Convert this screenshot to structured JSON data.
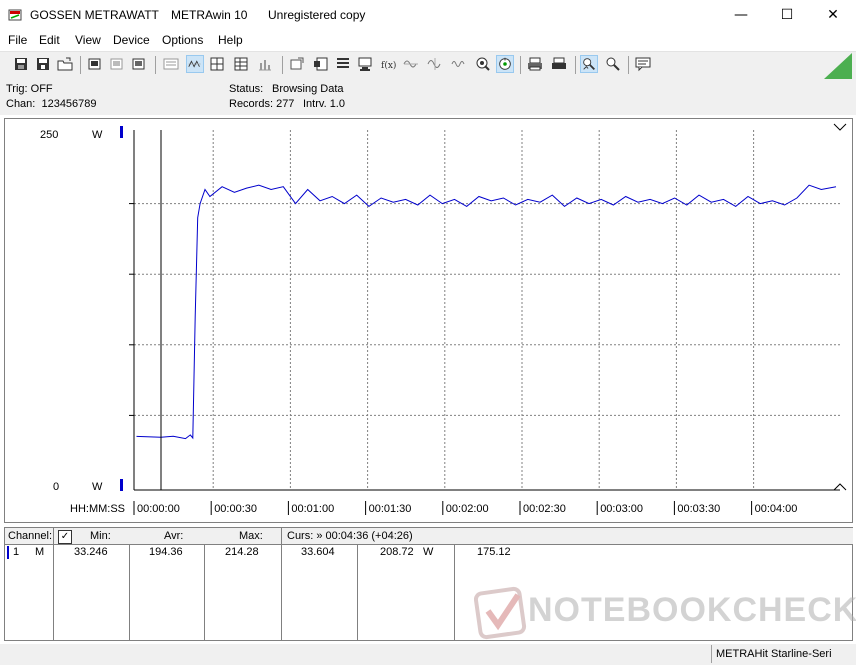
{
  "window": {
    "brand": "GOSSEN METRAWATT",
    "app_name": "METRAwin 10",
    "license": "Unregistered copy",
    "minimize_glyph": "—",
    "maximize_glyph": "☐",
    "close_glyph": "✕"
  },
  "menu": {
    "items": [
      "File",
      "Edit",
      "View",
      "Device",
      "Options",
      "Help"
    ]
  },
  "toolbar": {
    "icons": [
      "save-icon",
      "save-as-icon",
      "open-icon",
      "print-setup-icon",
      "device-icon",
      "device-disabled-icon",
      "grid-icon",
      "waveform-icon",
      "crosshair-icon",
      "table-icon",
      "bars-icon",
      "export-icon",
      "import-icon",
      "list-icon",
      "computer-icon",
      "formula-icon",
      "sine-icon",
      "sine-2-icon",
      "sine-3-icon",
      "probe-icon",
      "trigger-icon",
      "print-icon",
      "print-preview-icon",
      "zoom-icon",
      "cursor-icon",
      "message-icon"
    ],
    "active": [
      "waveform-icon",
      "trigger-icon",
      "zoom-icon"
    ]
  },
  "status": {
    "trig": "Trig: OFF",
    "chan": "Chan:  123456789",
    "status_label": "Status:",
    "status_value": "Browsing Data",
    "records_label": "Records: 277",
    "interval_label": "Intrv. 1.0"
  },
  "plot": {
    "y_max_label": "250",
    "y_min_label": "0",
    "unit_label": "W",
    "time_label": "HH:MM:SS",
    "x_ticks": [
      "00:00:00",
      "00:00:30",
      "00:01:00",
      "00:01:30",
      "00:02:00",
      "00:02:30",
      "00:03:00",
      "00:03:30",
      "00:04:00"
    ],
    "line_color": "#0000cc",
    "grid_color": "#808080"
  },
  "chart_data": {
    "type": "line",
    "xlabel": "HH:MM:SS",
    "ylabel": "W",
    "ylim": [
      0,
      250
    ],
    "x_tick_labels": [
      "00:00:00",
      "00:00:30",
      "00:01:00",
      "00:01:30",
      "00:02:00",
      "00:02:30",
      "00:03:00",
      "00:03:30",
      "00:04:00"
    ],
    "series": [
      {
        "name": "1 M",
        "x_seconds": [
          -10,
          0,
          5,
          10,
          12,
          13,
          14,
          15,
          16,
          18,
          20,
          25,
          30,
          35,
          40,
          45,
          50,
          55,
          60,
          65,
          70,
          75,
          80,
          85,
          90,
          95,
          100,
          105,
          110,
          115,
          120,
          125,
          130,
          135,
          140,
          145,
          150,
          155,
          160,
          165,
          170,
          175,
          180,
          185,
          190,
          195,
          200,
          205,
          210,
          215,
          220,
          225,
          230,
          235,
          240,
          245,
          250,
          255,
          260,
          265,
          270,
          276
        ],
        "values": [
          35.1,
          34.5,
          35.3,
          33.6,
          36.2,
          34.0,
          120,
          190,
          200,
          210,
          205,
          212,
          208,
          211,
          213,
          210,
          212,
          200,
          210,
          202,
          205,
          200,
          206,
          198,
          204,
          201,
          203,
          199,
          206,
          200,
          203,
          198,
          205,
          202,
          204,
          199,
          203,
          201,
          206,
          198,
          204,
          200,
          203,
          199,
          205,
          201,
          203,
          200,
          204,
          199,
          206,
          201,
          203,
          198,
          205,
          200,
          202,
          199,
          204,
          213,
          210,
          212
        ]
      }
    ]
  },
  "table": {
    "headers": {
      "channel": "Channel:",
      "check": "✓",
      "min": "Min:",
      "avr": "Avr:",
      "max": "Max:",
      "curs": "Curs: » 00:04:36 (+04:26)"
    },
    "row": {
      "channel": "1",
      "mode": "M",
      "min": "33.246",
      "avr": "194.36",
      "max": "214.28",
      "curs1": "33.604",
      "curs2": "208.72",
      "unit": "W",
      "curs3": "175.12"
    },
    "channel_color": "#0000cc"
  },
  "bottom": {
    "device_status": "METRAHit Starline-Seri"
  },
  "watermark": {
    "text": "NOTEBOOKCHECK"
  }
}
